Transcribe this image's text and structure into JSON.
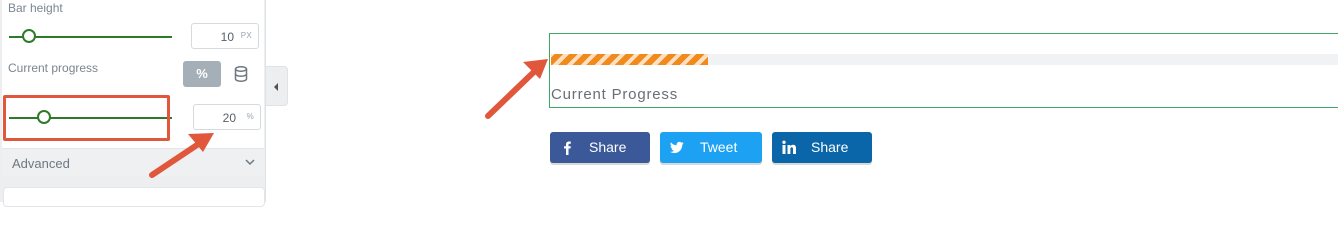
{
  "panel": {
    "bar_height": {
      "label": "Bar height",
      "value": "10",
      "unit": "PX",
      "level": 10
    },
    "current_progress": {
      "label": "Current progress",
      "value": "20",
      "unit": "%",
      "unit_toggle": "%",
      "level": 20
    },
    "advanced_label": "Advanced"
  },
  "preview": {
    "progress_title": "Current Progress",
    "progress_percent": 20,
    "fill_color": "#f18a1c",
    "share_buttons": [
      {
        "label": "Share",
        "icon": "facebook-icon",
        "color": "#3b5998"
      },
      {
        "label": "Tweet",
        "icon": "twitter-icon",
        "color": "#1da1f2"
      },
      {
        "label": "Share",
        "icon": "linkedin-icon",
        "color": "#0a66a8"
      }
    ]
  },
  "annotation_color": "#e0573b"
}
